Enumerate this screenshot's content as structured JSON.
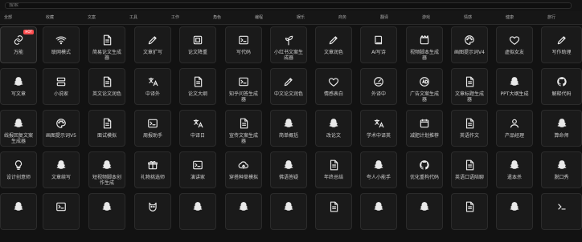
{
  "search": {
    "placeholder": "搜索"
  },
  "tabs": [
    {
      "label": "全部"
    },
    {
      "label": "收藏"
    },
    {
      "label": "文案"
    },
    {
      "label": "工具"
    },
    {
      "label": "工作"
    },
    {
      "label": "角色"
    },
    {
      "label": "编程"
    },
    {
      "label": "娱乐"
    },
    {
      "label": "商务"
    },
    {
      "label": "翻译"
    },
    {
      "label": "游戏"
    },
    {
      "label": "情感"
    },
    {
      "label": "健康"
    },
    {
      "label": "旅行"
    }
  ],
  "rows": [
    [
      {
        "label": "万能",
        "icon": "link-icon",
        "badge": "HOT"
      },
      {
        "label": "联网模式",
        "icon": "wifi-icon"
      },
      {
        "label": "简易论文生成器",
        "icon": "document-icon"
      },
      {
        "label": "文章扩写",
        "icon": "pencil-icon"
      },
      {
        "label": "论文降重",
        "icon": "scan-icon"
      },
      {
        "label": "写代码",
        "icon": "terminal-icon"
      },
      {
        "label": "小红书文案生成器",
        "icon": "sprout-icon"
      },
      {
        "label": "文章润色",
        "icon": "pencil-icon"
      },
      {
        "label": "AI写诗",
        "icon": "book-icon"
      },
      {
        "label": "视频脚本生成器",
        "icon": "clapboard-icon"
      },
      {
        "label": "画图提示词V4",
        "icon": "palette-icon"
      },
      {
        "label": "虚拟女友",
        "icon": "heart-icon"
      },
      {
        "label": "写作助理",
        "icon": "pencil-icon"
      }
    ],
    [
      {
        "label": "写文章",
        "icon": "ghost-icon"
      },
      {
        "label": "小说家",
        "icon": "server-icon"
      },
      {
        "label": "英文论文润色",
        "icon": "document-icon"
      },
      {
        "label": "中译外",
        "icon": "translate-icon"
      },
      {
        "label": "论文大纲",
        "icon": "document-icon"
      },
      {
        "label": "知乎问答生成器",
        "icon": "terminal-icon"
      },
      {
        "label": "中文论文润色",
        "icon": "pencil-icon"
      },
      {
        "label": "情感表白",
        "icon": "heart-icon"
      },
      {
        "label": "外译中",
        "icon": "gauge-icon"
      },
      {
        "label": "广告文案生成器",
        "icon": "ad-icon"
      },
      {
        "label": "文章标题生成器",
        "icon": "document-icon"
      },
      {
        "label": "PPT大纲生成",
        "icon": "ghost-icon"
      },
      {
        "label": "解释代码",
        "icon": "github-icon"
      }
    ],
    [
      {
        "label": "线报回复文案生成器",
        "icon": "ghost-icon"
      },
      {
        "label": "画图提示词V5",
        "icon": "palette-icon"
      },
      {
        "label": "面试模拟",
        "icon": "document-icon"
      },
      {
        "label": "周报助手",
        "icon": "terminal-icon"
      },
      {
        "label": "中译日",
        "icon": "translate-icon"
      },
      {
        "label": "宣传文案生成器",
        "icon": "document-icon"
      },
      {
        "label": "简单概括",
        "icon": "ghost-icon"
      },
      {
        "label": "改论文",
        "icon": "ghost-icon"
      },
      {
        "label": "学术中译英",
        "icon": "translate-icon"
      },
      {
        "label": "减肥计划推荐",
        "icon": "calendar-icon"
      },
      {
        "label": "英语作文",
        "icon": "document-icon"
      },
      {
        "label": "产品经理",
        "icon": "user-icon"
      },
      {
        "label": "算命师",
        "icon": "ghost-icon"
      }
    ],
    [
      {
        "label": "设计创意师",
        "icon": "bulb-icon"
      },
      {
        "label": "文章续写",
        "icon": "ghost-icon"
      },
      {
        "label": "短视频脚本创作生成",
        "icon": "ghost-icon"
      },
      {
        "label": "礼物挑选师",
        "icon": "gift-icon"
      },
      {
        "label": "演讲家",
        "icon": "terminal-icon"
      },
      {
        "label": "穿搭种草模拟",
        "icon": "cloud-upload-icon"
      },
      {
        "label": "佛语答疑",
        "icon": "ghost-icon"
      },
      {
        "label": "年终总结",
        "icon": "document-icon"
      },
      {
        "label": "夸人小能手",
        "icon": "ghost-icon"
      },
      {
        "label": "优化重构代码",
        "icon": "github-icon"
      },
      {
        "label": "英语口语陪聊",
        "icon": "document-icon"
      },
      {
        "label": "遣本杀",
        "icon": "ghost-icon"
      },
      {
        "label": "脱口秀",
        "icon": "ghost-icon"
      }
    ],
    [
      {
        "label": "",
        "icon": "ghost-icon"
      },
      {
        "label": "",
        "icon": "terminal-icon"
      },
      {
        "label": "",
        "icon": "ghost-icon"
      },
      {
        "label": "",
        "icon": "cat-icon"
      },
      {
        "label": "",
        "icon": "ghost-icon"
      },
      {
        "label": "",
        "icon": "ghost-icon"
      },
      {
        "label": "",
        "icon": "ghost-icon"
      },
      {
        "label": "",
        "icon": "document-icon"
      },
      {
        "label": "",
        "icon": "ghost-icon"
      },
      {
        "label": "",
        "icon": "ghost-icon"
      },
      {
        "label": "",
        "icon": "document-icon"
      },
      {
        "label": "",
        "icon": "ghost-icon"
      },
      {
        "label": "",
        "icon": "prompt-icon"
      }
    ]
  ]
}
